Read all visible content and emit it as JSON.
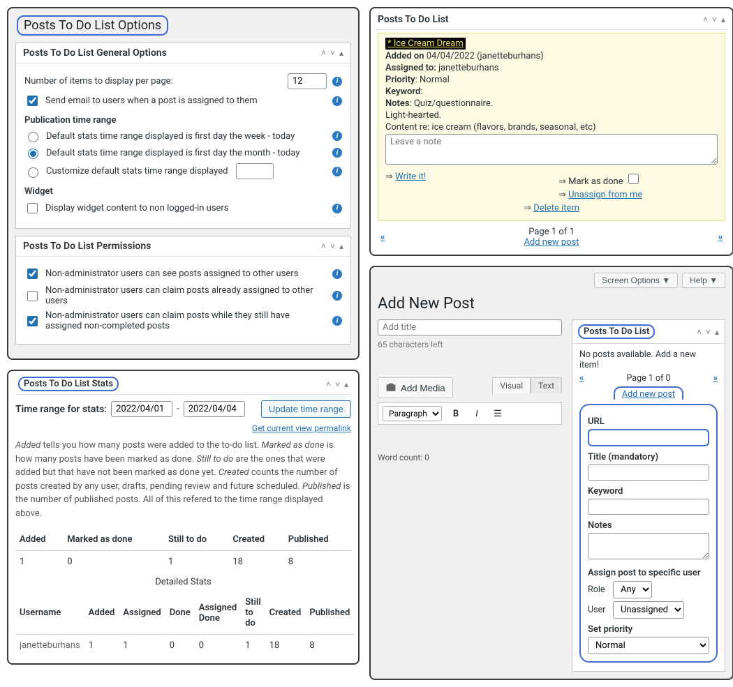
{
  "options": {
    "title": "Posts To Do List Options",
    "general": {
      "heading": "Posts To Do List General Options",
      "per_page_label": "Number of items to display per page:",
      "per_page_value": "12",
      "email_label": "Send email to users when a post is assigned to them",
      "pub_range_heading": "Publication time range",
      "radio_week": "Default stats time range displayed is first day the week - today",
      "radio_month": "Default stats time range displayed is first day the month - today",
      "radio_custom": "Customize default stats time range displayed",
      "widget_heading": "Widget",
      "widget_label": "Display widget content to non logged-in users"
    },
    "permissions": {
      "heading": "Posts To Do List Permissions",
      "p1": "Non-administrator users can see posts assigned to other users",
      "p2": "Non-administrator users can claim posts already assigned to other users",
      "p3": "Non-administrator users can claim posts while they still have assigned non-completed posts"
    }
  },
  "stats": {
    "heading": "Posts To Do List Stats",
    "range_label": "Time range for stats:",
    "from": "2022/04/01",
    "sep": "-",
    "to": "2022/04/04",
    "update_btn": "Update time range",
    "permalink": "Get current view permalink",
    "desc_added": "Added",
    "desc_added_t": " tells you how many posts were added to the to-do list. ",
    "desc_marked": "Marked as done",
    "desc_marked_t": " is how many posts have been marked as done. ",
    "desc_still": "Still to do",
    "desc_still_t": " are the ones that were added but that have not been marked as done yet. ",
    "desc_created": "Created",
    "desc_created_t": " counts the number of posts created by any user, drafts, pending review and future scheduled. ",
    "desc_published": "Published",
    "desc_published_t": " is the number of published posts. All of this refered to the time range displayed above.",
    "summary": {
      "h_added": "Added",
      "h_marked": "Marked as done",
      "h_still": "Still to do",
      "h_created": "Created",
      "h_pub": "Published",
      "v_added": "1",
      "v_marked": "0",
      "v_still": "1",
      "v_created": "18",
      "v_pub": "8"
    },
    "detailed_caption": "Detailed Stats",
    "detailed": {
      "h_user": "Username",
      "h_added": "Added",
      "h_assigned": "Assigned",
      "h_done": "Done",
      "h_adone": "Assigned Done",
      "h_still": "Still to do",
      "h_created": "Created",
      "h_pub": "Published",
      "user": "janetteburhans",
      "added": "1",
      "assigned": "1",
      "done": "0",
      "adone": "0",
      "still": "1",
      "created": "18",
      "pub": "8"
    }
  },
  "todobox": {
    "heading": "Posts To Do List",
    "item_title": "* Ice Cream Dream",
    "added_label": "Added on",
    "added_val": " 04/04/2022 (janetteburhans)",
    "assigned_label": "Assigned to:",
    "assigned_val": " janetteburhans",
    "priority_label": "Priority",
    "priority_val": ": Normal",
    "keyword_label": "Keyword",
    "keyword_val": ":",
    "notes_label": "Notes",
    "notes_val": ": Quiz/questionnaire.",
    "notes2": "Light-hearted.",
    "notes3": "Content re: ice cream (flavors, brands, seasonal, etc)",
    "textarea_ph": "Leave a note",
    "write_it": "Write it!",
    "mark_done": "Mark as done",
    "unassign": "Unassign from me",
    "delete": "Delete item",
    "page": "Page 1 of 1",
    "add_new": "Add new post"
  },
  "editor": {
    "screen_options": "Screen Options ▼",
    "help": "Help ▼",
    "h1": "Add New Post",
    "title_ph": "Add title",
    "chars": "65 characters left",
    "add_media": "Add Media",
    "tab_visual": "Visual",
    "tab_text": "Text",
    "toolbar_select": "Paragraph",
    "word_count": "Word count: 0",
    "side": {
      "heading": "Posts To Do List",
      "none": "No posts available. Add a new item!",
      "page": "Page 1 of 0",
      "add_new": "Add new post",
      "url": "URL",
      "title": "Title (mandatory)",
      "keyword": "Keyword",
      "notes": "Notes",
      "assign_heading": "Assign post to specific user",
      "role_label": "Role",
      "role_val": "Any",
      "user_label": "User",
      "user_val": "Unassigned",
      "prio_heading": "Set priority",
      "prio_val": "Normal"
    }
  }
}
